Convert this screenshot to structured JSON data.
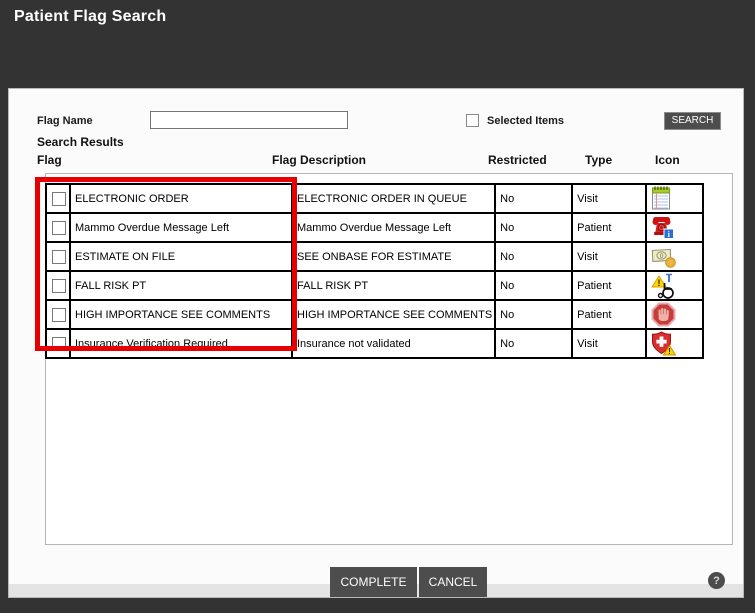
{
  "window": {
    "title": "Patient Flag Search"
  },
  "search_bar": {
    "flag_name_label": "Flag Name",
    "flag_name_value": "",
    "selected_items_label": "Selected Items",
    "selected_items_checked": false,
    "search_button_label": "SEARCH"
  },
  "results": {
    "section_title": "Search Results",
    "columns": [
      "Flag",
      "Flag Description",
      "Restricted",
      "Type",
      "Icon"
    ],
    "rows": [
      {
        "checked": false,
        "flag": "ELECTRONIC ORDER",
        "description": "ELECTRONIC ORDER IN QUEUE",
        "restricted": "No",
        "type": "Visit",
        "icon": "notepad-icon"
      },
      {
        "checked": false,
        "flag": "Mammo Overdue Message Left",
        "description": "Mammo Overdue Message Left",
        "restricted": "No",
        "type": "Patient",
        "icon": "phone-message-icon"
      },
      {
        "checked": false,
        "flag": "ESTIMATE ON FILE",
        "description": "SEE ONBASE FOR ESTIMATE",
        "restricted": "No",
        "type": "Visit",
        "icon": "money-icon"
      },
      {
        "checked": false,
        "flag": "FALL RISK PT",
        "description": "FALL RISK PT",
        "restricted": "No",
        "type": "Patient",
        "icon": "fall-risk-icon"
      },
      {
        "checked": false,
        "flag": "HIGH IMPORTANCE SEE COMMENTS",
        "description": "HIGH IMPORTANCE SEE COMMENTS",
        "restricted": "No",
        "type": "Patient",
        "icon": "stop-hand-icon"
      },
      {
        "checked": false,
        "flag": "Insurance Verification Required",
        "description": "Insurance not validated",
        "restricted": "No",
        "type": "Visit",
        "icon": "medical-shield-warning-icon"
      }
    ]
  },
  "footer": {
    "complete_button_label": "COMPLETE",
    "cancel_button_label": "CANCEL",
    "help_icon": "?"
  },
  "colors": {
    "frame": "#333333",
    "button": "#4d4d4d",
    "highlight": "#e60000"
  }
}
